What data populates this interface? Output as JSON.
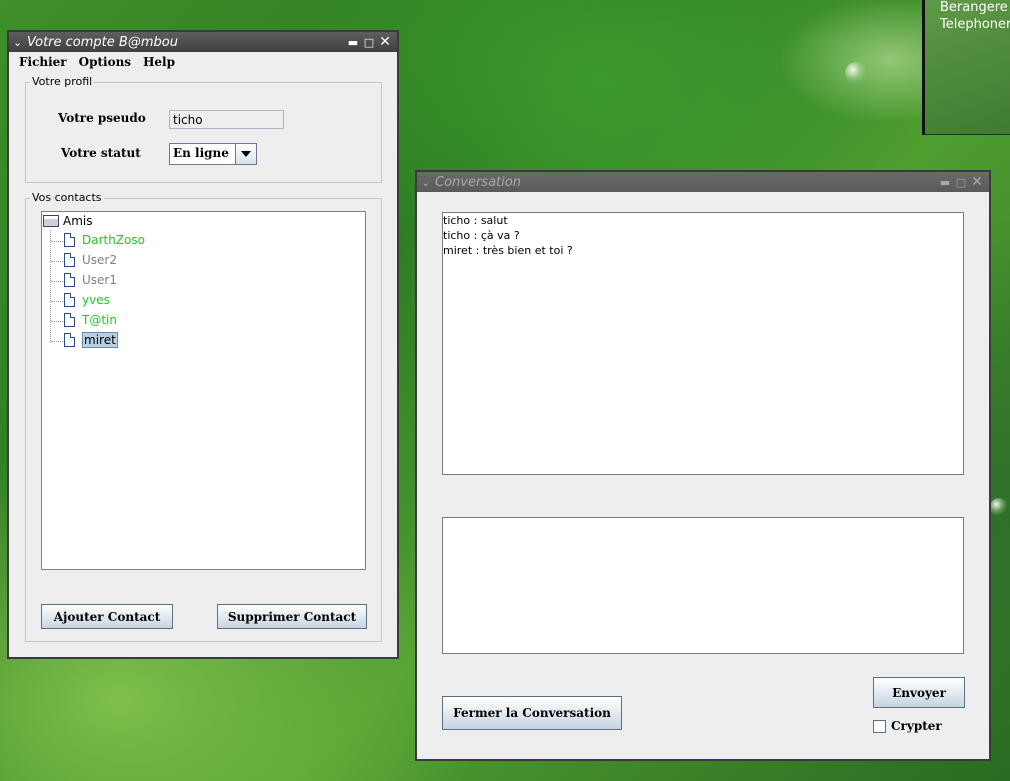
{
  "desktop": {
    "bg_text_1": "Berangere",
    "bg_text_2": "Telephoner"
  },
  "account_window": {
    "title": "Votre compte B@mbou",
    "menu": [
      "Fichier",
      "Options",
      "Help"
    ],
    "profile": {
      "group_label": "Votre profil",
      "pseudo_label": "Votre pseudo",
      "pseudo_value": "ticho",
      "status_label": "Votre statut",
      "status_value": "En ligne"
    },
    "contacts": {
      "group_label": "Vos contacts",
      "root_label": "Amis",
      "items": [
        {
          "name": "DarthZoso",
          "color": "#1fc91f"
        },
        {
          "name": "User2",
          "color": "#808080"
        },
        {
          "name": "User1",
          "color": "#808080"
        },
        {
          "name": "yves",
          "color": "#1fc91f"
        },
        {
          "name": "T@tin",
          "color": "#1fc91f"
        },
        {
          "name": "miret",
          "color": "#000000",
          "selected": true
        }
      ],
      "add_button": "Ajouter Contact",
      "remove_button": "Supprimer Contact"
    }
  },
  "conversation_window": {
    "title": "Conversation",
    "messages": [
      "ticho : salut",
      "ticho : çà va ?",
      "miret : très bien et toi ?"
    ],
    "input_value": "",
    "send_button": "Envoyer",
    "close_button": "Fermer la Conversation",
    "encrypt_label": "Crypter"
  }
}
